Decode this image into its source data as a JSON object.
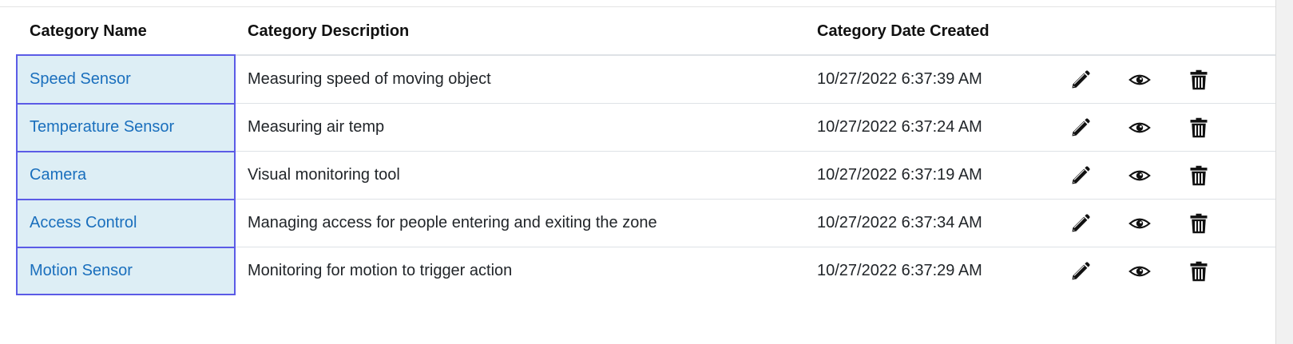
{
  "table": {
    "headers": {
      "name": "Category Name",
      "description": "Category Description",
      "date_created": "Category Date Created"
    },
    "rows": [
      {
        "name": "Speed Sensor",
        "description": "Measuring speed of moving object",
        "date_created": "10/27/2022 6:37:39 AM"
      },
      {
        "name": "Temperature Sensor",
        "description": "Measuring air temp",
        "date_created": "10/27/2022 6:37:24 AM"
      },
      {
        "name": "Camera",
        "description": "Visual monitoring tool",
        "date_created": "10/27/2022 6:37:19 AM"
      },
      {
        "name": "Access Control",
        "description": "Managing access for people entering and exiting the zone",
        "date_created": "10/27/2022 6:37:34 AM"
      },
      {
        "name": "Motion Sensor",
        "description": "Monitoring for motion to trigger action",
        "date_created": "10/27/2022 6:37:29 AM"
      }
    ],
    "row_actions": [
      "pencil-icon",
      "eye-icon",
      "trash-icon"
    ]
  },
  "colors": {
    "link": "#1a6fbd",
    "selected_cell_bg": "#ddeef5",
    "selected_cell_border": "#5b5be6",
    "row_divider": "#dee2e6"
  }
}
